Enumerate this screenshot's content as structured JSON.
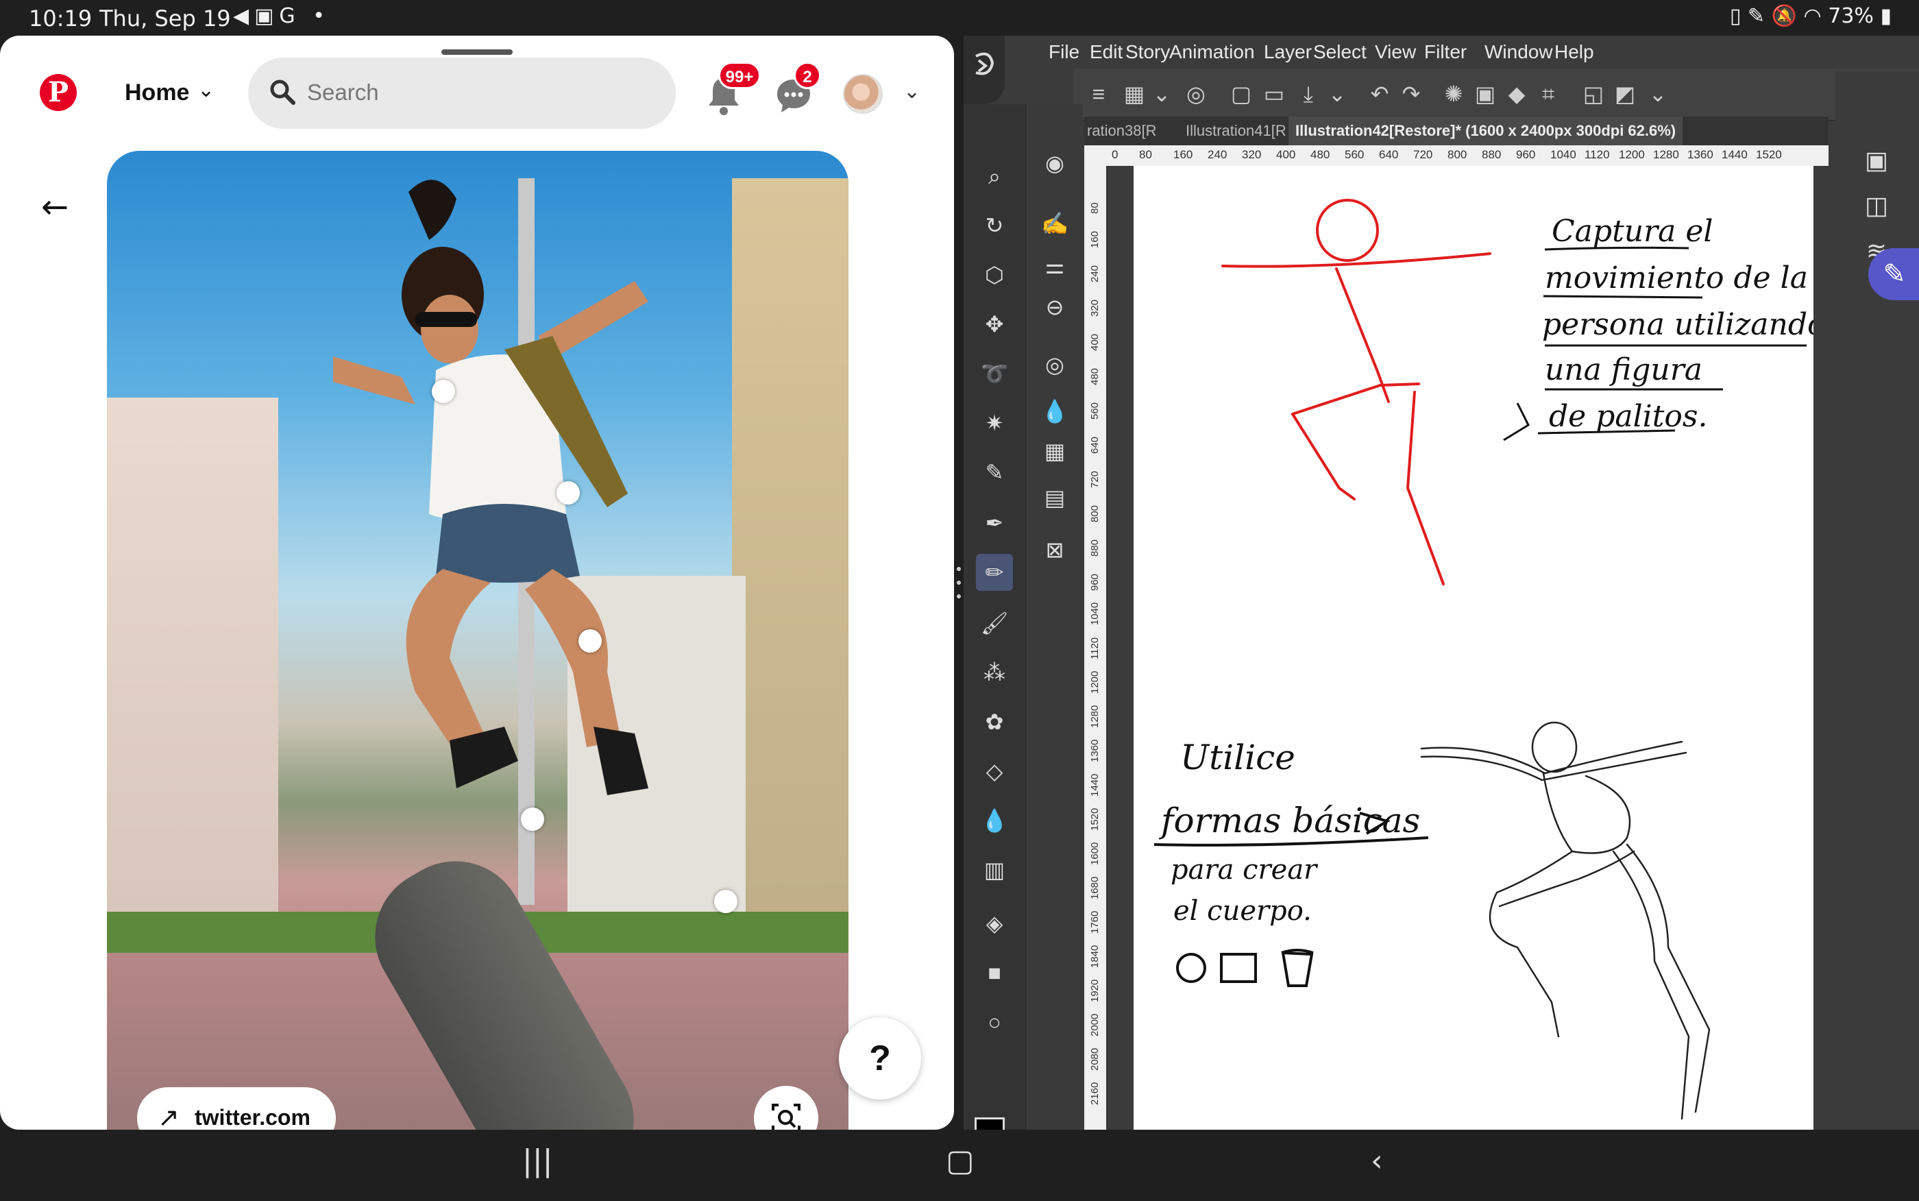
{
  "status": {
    "time": "10:19",
    "date": "Thu, Sep 19",
    "battery": "73%"
  },
  "pinterest": {
    "home_label": "Home",
    "search_placeholder": "Search",
    "notif_badge": "99+",
    "msg_badge": "2",
    "source_link": "twitter.com",
    "help": "?"
  },
  "csp": {
    "menu": [
      "File",
      "Edit",
      "Story",
      "Animation",
      "Layer",
      "Select",
      "View",
      "Filter",
      "Window",
      "Help"
    ],
    "tabs": [
      "ration38[R",
      "Illustration41[R"
    ],
    "active_tab": "Illustration42[Restore]* (1600 x 2400px 300dpi 62.6%)",
    "ruler_ticks": [
      "0",
      "80",
      "160",
      "240",
      "320",
      "400",
      "480",
      "560",
      "640",
      "720",
      "800",
      "880",
      "960",
      "1040",
      "1120",
      "1200",
      "1280",
      "1360",
      "1440",
      "1520"
    ],
    "ruler_v_ticks": [
      "80",
      "160",
      "240",
      "320",
      "400",
      "480",
      "560",
      "640",
      "720",
      "800",
      "880",
      "960",
      "1040",
      "1120",
      "1200",
      "1280",
      "1360",
      "1440",
      "1520",
      "1600",
      "1680",
      "1760",
      "1840",
      "1920",
      "2000",
      "2080",
      "2160"
    ],
    "note1": [
      "Captura el",
      "movimiento de la",
      "persona utilizando",
      "una figura",
      "de palitos."
    ],
    "note2": [
      "Utilice",
      "formas básicas",
      "para crear",
      "el cuerpo."
    ],
    "colors": {
      "main": "#000000",
      "sub": "#e00000"
    }
  }
}
